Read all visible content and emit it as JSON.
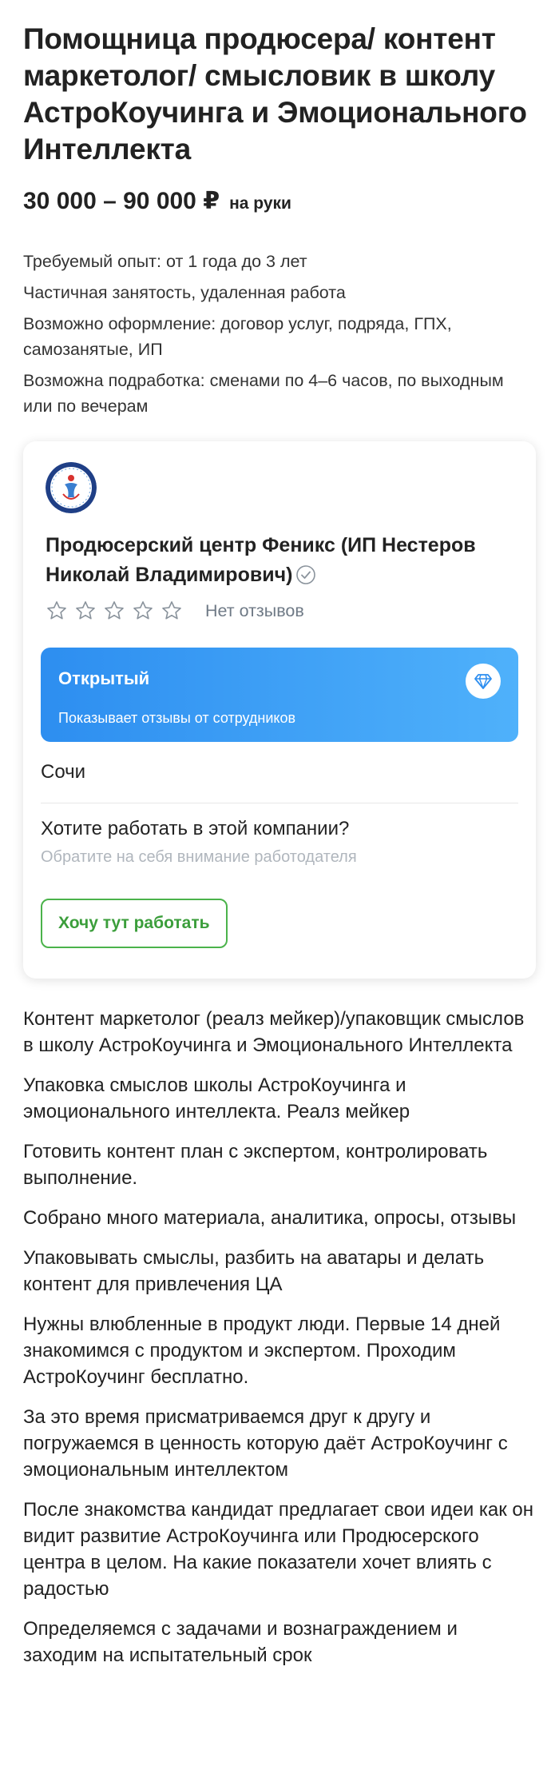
{
  "vacancy": {
    "title": "Помощница продюсера/ контент маркетолог/ смысловик в школу АстроКоучинга и Эмоционального Интеллекта",
    "salary_range": "30 000 – 90 000 ₽",
    "salary_note": "на руки",
    "experience": "Требуемый опыт: от 1 года до 3 лет",
    "employment": "Частичная занятость, удаленная работа",
    "contract": "Возможно оформление: договор услуг, подряда, ГПХ, самозанятые, ИП",
    "side_job": "Возможна подработка: сменами по 4–6 часов, по выходным или по вечерам"
  },
  "company": {
    "name": "Продюсерский центр Феникс (ИП Нестеров Николай Владимирович)",
    "rating_stars": 0,
    "no_reviews": "Нет отзывов",
    "open_title": "Открытый",
    "open_subtitle": "Показывает отзывы от сотрудников",
    "city": "Сочи",
    "want_title": "Хотите работать в этой компании?",
    "want_subtitle": "Обратите на себя внимание работодателя",
    "want_button": "Хочу тут работать",
    "colors": {
      "banner_start": "#2d8ef0",
      "banner_end": "#4fb1fb",
      "button_green": "#4bb34b",
      "logo_blue": "#1f3f86"
    }
  },
  "description": [
    "Контент маркетолог (реалз мейкер)/упаковщик смыслов в школу АстроКоучинга и Эмоционального Интеллекта",
    "Упаковка смыслов школы АстроКоучинга и эмоционального интеллекта. Реалз мейкер",
    "Готовить контент план с экспертом, контролировать выполнение.",
    "Собрано много материала, аналитика, опросы, отзывы",
    "Упаковывать смыслы, разбить на аватары и делать контент для привлечения ЦА",
    "Нужны влюбленные в продукт люди. Первые 14 дней знакомимся с продуктом и экспертом. Проходим АстроКоучинг бесплатно.",
    "За это время присматриваемся друг к другу и погружаемся в ценность которую даёт АстроКоучинг с эмоциональным интеллектом",
    "После знакомства кандидат предлагает свои идеи как он видит развитие АстроКоучинга или Продюсерского центра в целом. На какие показатели хочет влиять с радостью",
    "Определяемся с задачами и вознаграждением и заходим на испытательный срок"
  ]
}
